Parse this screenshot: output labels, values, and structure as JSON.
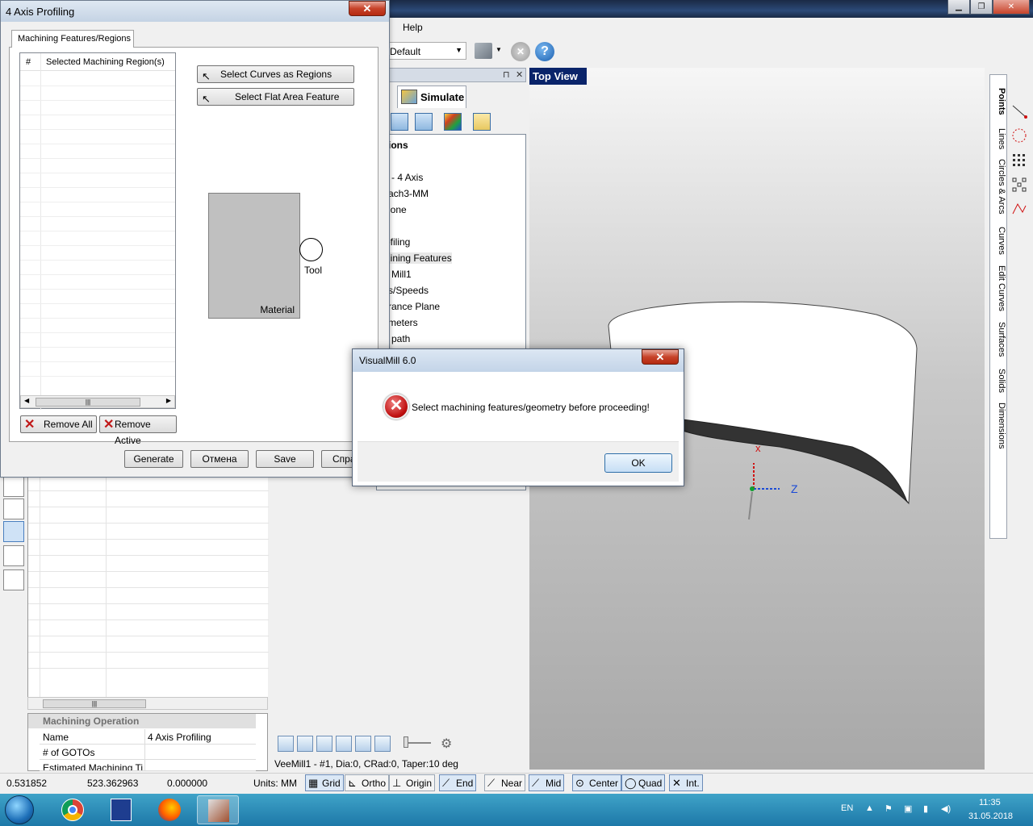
{
  "app": {
    "menu_help": "Help",
    "layer_combo": "Default",
    "simulate_tab": "Simulate",
    "viewport_label": "Top View",
    "axis_z_label": "Z",
    "axis_x_label": "x"
  },
  "tree": {
    "items": [
      "tions",
      "- 4 Axis",
      "ach3-MM",
      "lone",
      "ofiling",
      "hining Features",
      "Mill1",
      "s/Speeds",
      "rance Plane",
      "meters",
      "path"
    ]
  },
  "right_tabs": [
    "Points",
    "Lines",
    "Circles & Arcs",
    "Curves",
    "Edit Curves",
    "Surfaces",
    "Solids",
    "Dimensions"
  ],
  "properties": {
    "header": "Machining Operation",
    "rows": [
      {
        "key": "Name",
        "value": "4 Axis Profiling"
      },
      {
        "key": "# of GOTOs",
        "value": ""
      },
      {
        "key": "Estimated Machining Ti",
        "value": ""
      }
    ]
  },
  "tool_info": "VeeMill1 - #1, Dia:0, CRad:0, Taper:10 deg",
  "status": {
    "x": "0.531852",
    "y": "523.362963",
    "z": "0.000000",
    "units": "Units: MM",
    "grid": "Grid",
    "ortho": "Ortho",
    "origin": "Origin",
    "end": "End",
    "near": "Near",
    "mid": "Mid",
    "center": "Center",
    "quad": "Quad",
    "int": "Int."
  },
  "profiling_dialog": {
    "title": "4 Axis Profiling",
    "tab": "Machining Features/Regions",
    "list_col_num": "#",
    "list_col_region": "Selected Machining Region(s)",
    "btn_select_curves": "Select Curves as Regions",
    "btn_select_flat": "Select Flat Area Feature",
    "material_label": "Material",
    "tool_label": "Tool",
    "btn_remove_all": "Remove All",
    "btn_remove_active": "Remove Active",
    "btn_generate": "Generate",
    "btn_cancel": "Отмена",
    "btn_save": "Save",
    "btn_help": "Спра"
  },
  "error_dialog": {
    "title": "VisualMill 6.0",
    "message": "Select machining features/geometry before proceeding!",
    "ok": "OK"
  },
  "taskbar": {
    "lang": "EN",
    "time": "11:35",
    "date": "31.05.2018"
  },
  "colors": {
    "title_dark": "#1a2a45",
    "viewport_label_bg": "#0a246a",
    "error_red": "#c01010",
    "taskbar": "#1d78a8"
  }
}
